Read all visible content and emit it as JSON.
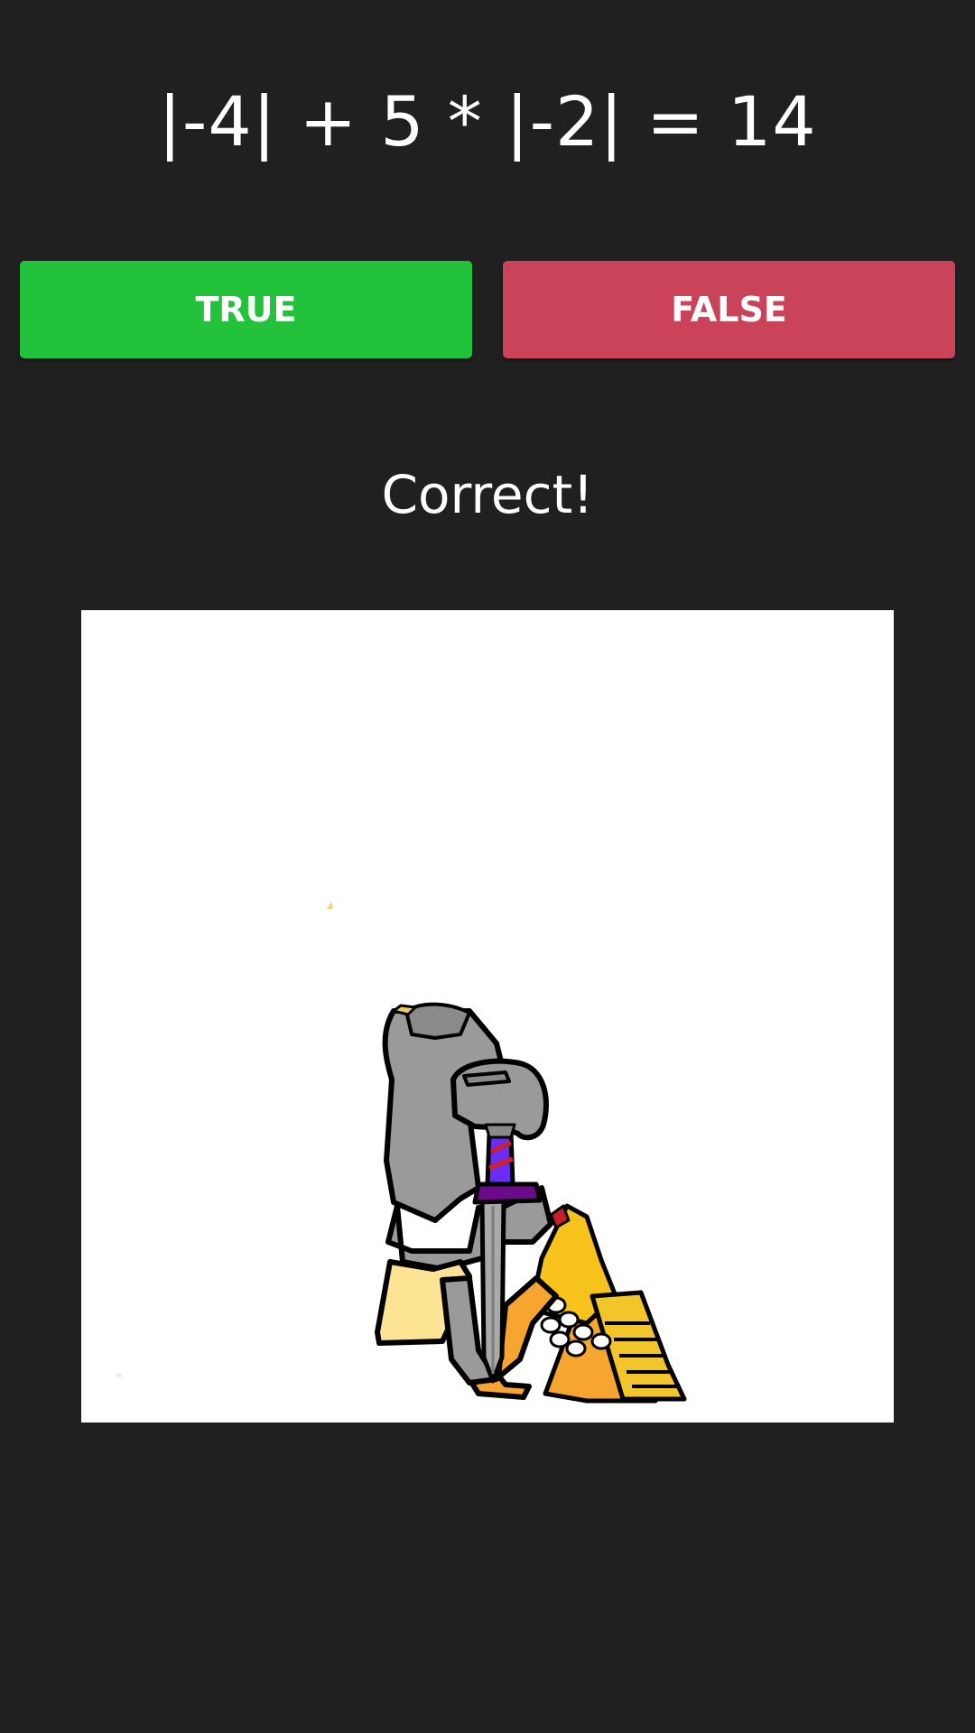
{
  "question": {
    "equation": "|-4| + 5 * |-2| = 14"
  },
  "answers": {
    "true_label": "TRUE",
    "false_label": "FALSE",
    "true_color": "#22c33a",
    "false_color": "#cb4358"
  },
  "result": {
    "message": "Correct!"
  },
  "picture": {
    "subject": "knight-with-sword-and-treasure-illustration"
  },
  "theme": {
    "background": "#202020",
    "text": "#ffffff",
    "panel": "#ffffff"
  }
}
